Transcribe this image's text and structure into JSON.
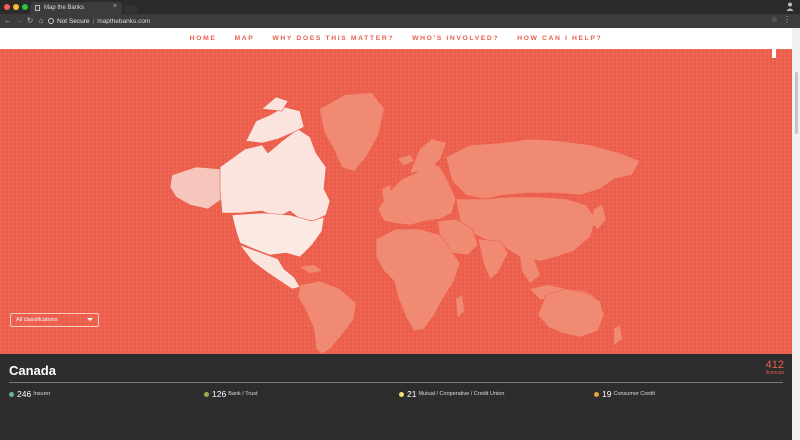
{
  "browser": {
    "tab_title": "Map the Banks",
    "security_label": "Not Secure",
    "url": "mapthebanks.com"
  },
  "nav": {
    "items": [
      "HOME",
      "MAP",
      "WHY DOES THIS MATTER?",
      "WHO'S INVOLVED?",
      "HOW CAN I HELP?"
    ]
  },
  "filter": {
    "selected": "All classifications"
  },
  "panel": {
    "country": "Canada",
    "total": "412",
    "total_label": "licences",
    "stats": [
      {
        "count": "246",
        "label": "Insurer",
        "color": "#63b88e"
      },
      {
        "count": "126",
        "label": "Bank / Trust",
        "color": "#a2a84d"
      },
      {
        "count": "21",
        "label": "Mutual / Cooperative / Credit Union",
        "color": "#f0e070"
      },
      {
        "count": "19",
        "label": "Consumer Credit",
        "color": "#e7a33e"
      }
    ]
  },
  "colors": {
    "accent": "#ec5e4b",
    "land": "#f08a73",
    "highlight": "#f6cfc6",
    "panel": "#2d2d2d"
  }
}
